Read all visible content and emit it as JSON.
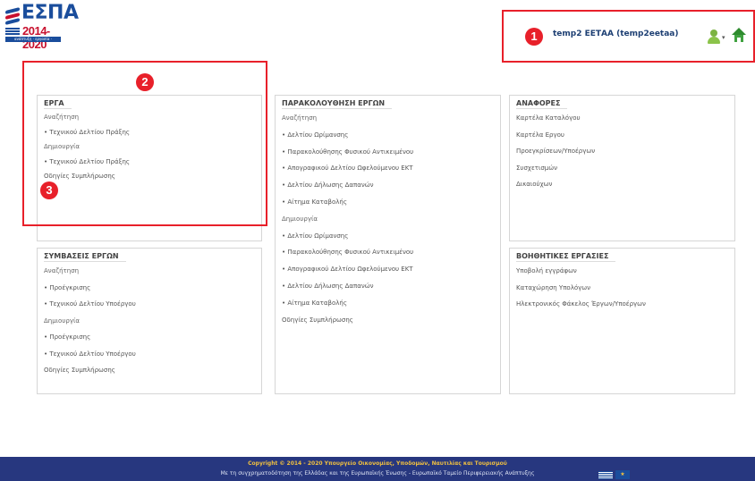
{
  "header": {
    "logo": {
      "title": "ΕΣΠΑ",
      "years": "2014-2020",
      "tagline": "ανάπτυξη · εργασία · αλληλεγγύη"
    },
    "user_label": "temp2 ΕΕΤΑΑ (temp2eetaa)",
    "badge_1": "1",
    "icons": [
      "user-menu-icon",
      "home-icon"
    ]
  },
  "annotations": {
    "badge_2": "2",
    "badge_3": "3",
    "highlight_color": "#e8202a"
  },
  "panels": {
    "erga": {
      "title": "ΕΡΓΑ",
      "items": [
        "Αναζήτηση",
        "• Τεχνικού Δελτίου Πράξης",
        "Δημιουργία",
        "• Τεχνικού Δελτίου Πράξης",
        "Οδηγίες Συμπλήρωσης"
      ]
    },
    "symvaseis": {
      "title": "ΣΥΜΒΑΣΕΙΣ ΕΡΓΩΝ",
      "items": [
        "Αναζήτηση",
        "• Προέγκρισης",
        "• Τεχνικού Δελτίου Υποέργου",
        "Δημιουργία",
        "• Προέγκρισης",
        "• Τεχνικού Δελτίου Υποέργου",
        "Οδηγίες Συμπλήρωσης"
      ]
    },
    "parakolouthisi": {
      "title": "ΠΑΡΑΚΟΛΟΥΘΗΣΗ ΕΡΓΩΝ",
      "items": [
        "Αναζήτηση",
        "• Δελτίου Ωρίμανσης",
        "• Παρακολούθησης Φυσικού Αντικειμένου",
        "• Απογραφικού Δελτίου Ωφελούμενου ΕΚΤ",
        "• Δελτίου Δήλωσης Δαπανών",
        "• Αίτημα Καταβολής",
        "Δημιουργία",
        "• Δελτίου Ωρίμανσης",
        "• Παρακολούθησης Φυσικού Αντικειμένου",
        "• Απογραφικού Δελτίου Ωφελούμενου ΕΚΤ",
        "• Δελτίου Δήλωσης Δαπανών",
        "• Αίτημα Καταβολής",
        "Οδηγίες Συμπλήρωσης"
      ]
    },
    "anafores": {
      "title": "ΑΝΑΦΟΡΕΣ",
      "items": [
        "Καρτέλα Καταλόγου",
        "Καρτέλα Εργου",
        "Προεγκρίσεων/Υποέργων",
        "Συσχετισμών",
        "Δικαιούχων"
      ]
    },
    "voithitikes": {
      "title": "ΒΟΗΘΗΤΙΚΕΣ ΕΡΓΑΣΙΕΣ",
      "items": [
        "Υποβολή εγγράφων",
        "Καταχώρηση Υπολόγων",
        "Ηλεκτρονικός Φάκελος Έργων/Υποέργων"
      ]
    }
  },
  "footer": {
    "copyright": "Copyright © 2014 - 2020 Υπουργείο Οικονομίας, Υποδομών, Ναυτιλίας και Τουρισμού",
    "cofunding": "Με τη συγχρηματοδότηση της Ελλάδας και της Ευρωπαϊκής Ένωσης - Ευρωπαϊκό Ταμείο Περιφερειακής Ανάπτυξης",
    "footer_color": "#27377f"
  }
}
